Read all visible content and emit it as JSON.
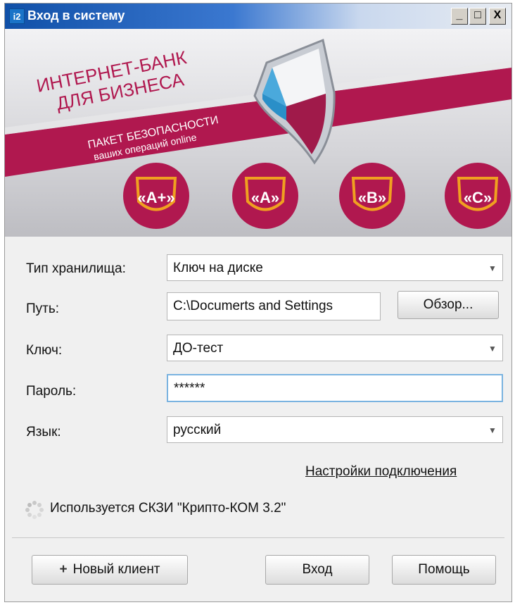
{
  "window": {
    "title": "Вход в систему",
    "app_icon_text": "i2",
    "controls": {
      "minimize": "_",
      "maximize": "□",
      "close": "X"
    }
  },
  "banner": {
    "headline_line1": "ИНТЕРНЕТ-БАНК",
    "headline_line2": "ДЛЯ БИЗНЕСА",
    "ribbon_line1": "ПАКЕТ БЕЗОПАСНОСТИ",
    "ribbon_line2": "ваших операций online",
    "badges": [
      "«A+»",
      "«A»",
      "«B»",
      "«C»"
    ],
    "colors": {
      "accent": "#b0184f",
      "badge_border": "#f0a020"
    }
  },
  "form": {
    "storage": {
      "label": "Тип хранилища:",
      "value": "Ключ на диске"
    },
    "path": {
      "label": "Путь:",
      "value": "C:\\Documerts and Settings",
      "browse_label": "Обзор..."
    },
    "key": {
      "label": "Ключ:",
      "value": "ДО-тест"
    },
    "password": {
      "label": "Пароль:",
      "value": "******"
    },
    "language": {
      "label": "Язык:",
      "value": "русский"
    }
  },
  "connection_settings_link": "Настройки подключения",
  "crypto_status": "Используется СКЗИ \"Крипто-КОМ 3.2\"",
  "footer": {
    "new_client_label": "Новый клиент",
    "login_label": "Вход",
    "help_label": "Помощь"
  }
}
